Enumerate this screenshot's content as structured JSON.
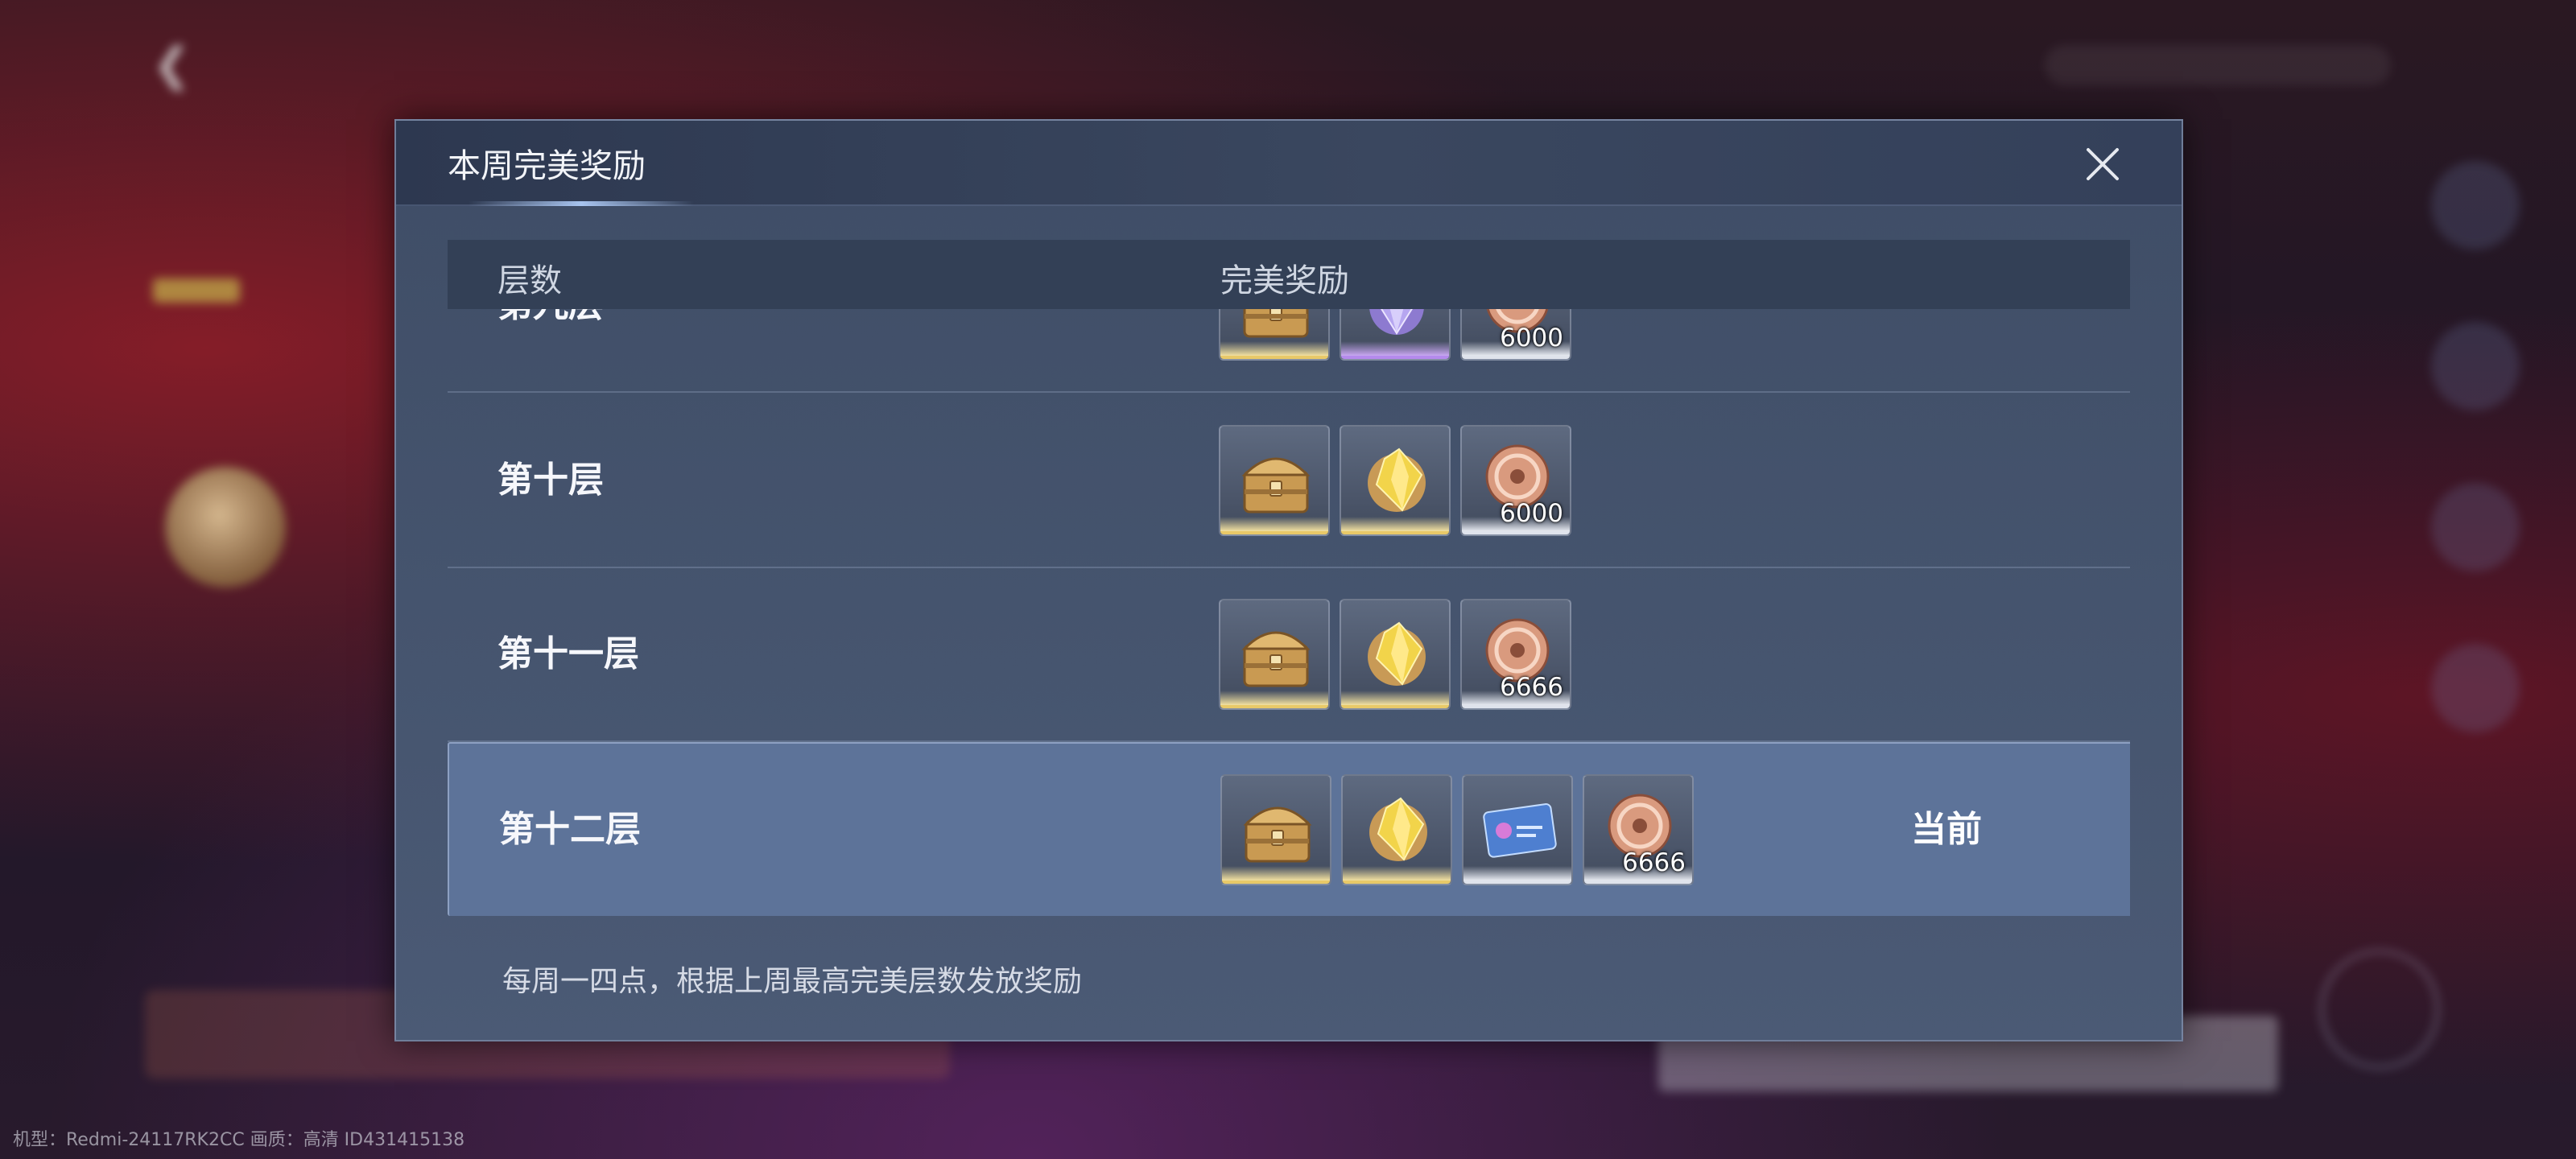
{
  "modal": {
    "title": "本周完美奖励",
    "close_icon": "close-icon",
    "columns": {
      "floor": "层数",
      "reward": "完美奖励"
    },
    "rows": [
      {
        "floor": "第九层",
        "rewards": [
          {
            "icon": "treasure-chest-icon",
            "rarity": "gold",
            "qty": ""
          },
          {
            "icon": "purple-crystal-icon",
            "rarity": "purple",
            "qty": ""
          },
          {
            "icon": "copper-coin-icon",
            "rarity": "white",
            "qty": "6000"
          }
        ],
        "status": ""
      },
      {
        "floor": "第十层",
        "rewards": [
          {
            "icon": "treasure-chest-icon",
            "rarity": "gold",
            "qty": ""
          },
          {
            "icon": "gold-crystal-icon",
            "rarity": "gold",
            "qty": ""
          },
          {
            "icon": "copper-coin-icon",
            "rarity": "white",
            "qty": "6000"
          }
        ],
        "status": ""
      },
      {
        "floor": "第十一层",
        "rewards": [
          {
            "icon": "treasure-chest-icon",
            "rarity": "gold",
            "qty": ""
          },
          {
            "icon": "gold-crystal-icon",
            "rarity": "gold",
            "qty": ""
          },
          {
            "icon": "copper-coin-icon",
            "rarity": "white",
            "qty": "6666"
          }
        ],
        "status": ""
      },
      {
        "floor": "第十二层",
        "rewards": [
          {
            "icon": "treasure-chest-icon",
            "rarity": "gold",
            "qty": ""
          },
          {
            "icon": "gold-crystal-icon",
            "rarity": "gold",
            "qty": ""
          },
          {
            "icon": "ticket-icon",
            "rarity": "white",
            "qty": ""
          },
          {
            "icon": "copper-coin-icon",
            "rarity": "white",
            "qty": "6666"
          }
        ],
        "status": "当前"
      }
    ],
    "footer_note": "每周一四点，根据上周最高完美层数发放奖励"
  },
  "device_info": "机型：Redmi-24117RK2CC 画质：高清 ID431415138",
  "colors": {
    "modal_bg": "#46556f",
    "header_bg": "#2d3850",
    "current_row": "#5d7399",
    "rarity_gold": "#e8c968",
    "rarity_purple": "#b58aed",
    "rarity_white": "#dfe3ec"
  }
}
